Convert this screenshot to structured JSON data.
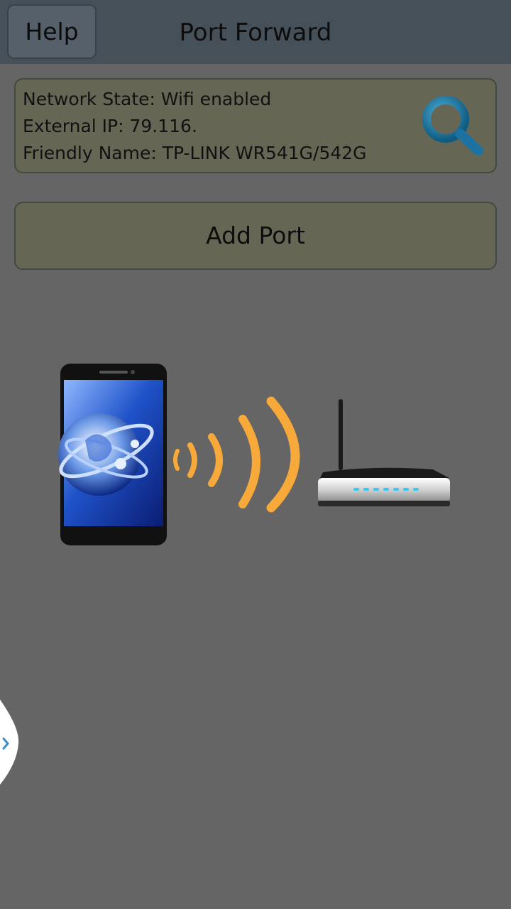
{
  "header": {
    "help_label": "Help",
    "title": "Port Forward"
  },
  "network_info": {
    "network_state": "Network State: Wifi enabled",
    "external_ip": "External IP: 79.116.",
    "friendly_name": "Friendly Name: TP-LINK WR541G/542G"
  },
  "actions": {
    "add_port_label": "Add Port"
  },
  "icons": {
    "search": "search-icon",
    "phone": "smartphone-icon",
    "wifi": "wifi-signal-icon",
    "router": "router-icon",
    "edge_tab": "chevron-right-icon"
  },
  "colors": {
    "background": "#656565",
    "header": "#465059",
    "card": "#666655",
    "wifi_waves": "#f7a93a",
    "search_icon": "#1a6b93"
  }
}
